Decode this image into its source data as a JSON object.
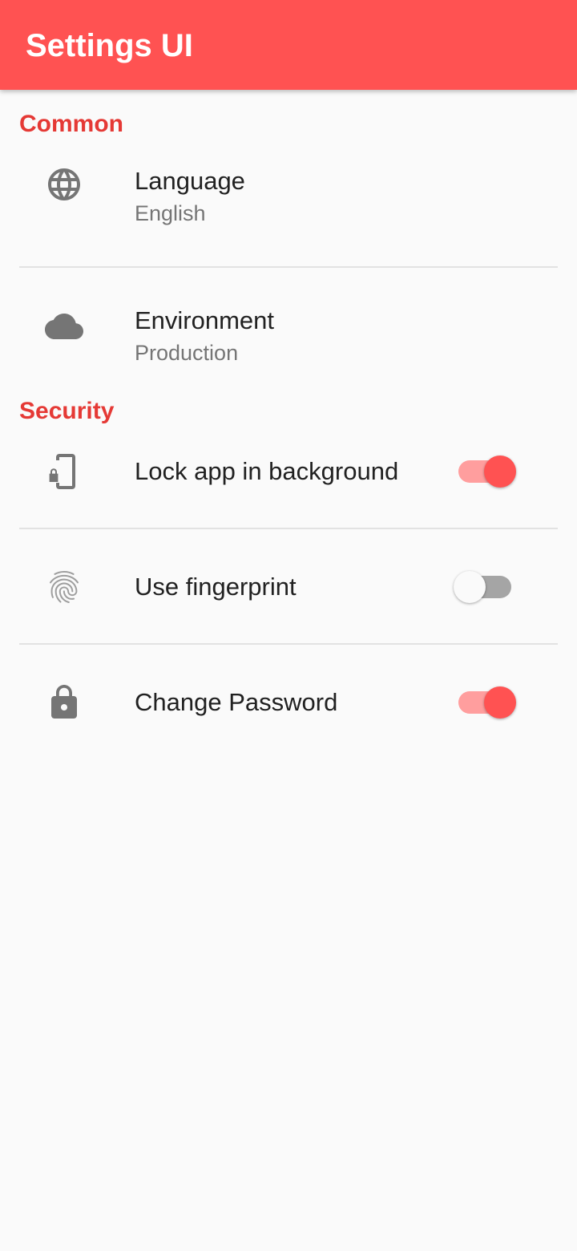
{
  "app_bar": {
    "title": "Settings UI",
    "color": "#ff5252"
  },
  "sections": [
    {
      "title": "Common",
      "tiles": [
        {
          "icon": "globe-icon",
          "title": "Language",
          "subtitle": "English"
        },
        {
          "icon": "cloud-icon",
          "title": "Environment",
          "subtitle": "Production"
        }
      ]
    },
    {
      "title": "Security",
      "tiles": [
        {
          "icon": "phone-lock-icon",
          "title": "Lock app in background",
          "switch_on": true
        },
        {
          "icon": "fingerprint-icon",
          "title": "Use fingerprint",
          "switch_on": false
        },
        {
          "icon": "lock-icon",
          "title": "Change Password",
          "switch_on": true
        }
      ]
    }
  ],
  "colors": {
    "accent": "#ff5252",
    "section_title": "#e53935",
    "icon": "#757575"
  }
}
